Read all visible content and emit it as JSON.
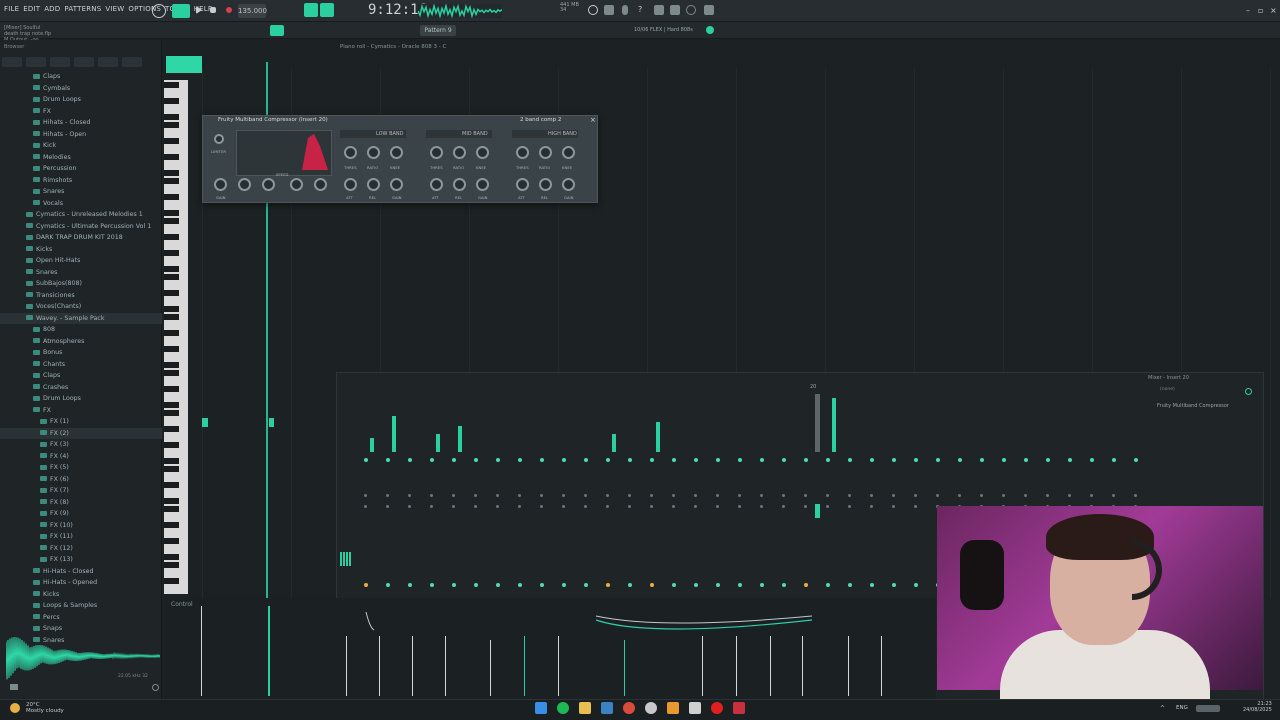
{
  "menu": [
    "FILE",
    "EDIT",
    "ADD",
    "PATTERNS",
    "VIEW",
    "OPTIONS",
    "TOOLS",
    "HELP"
  ],
  "hint_lines": [
    "[Mixer] Soulful",
    "death trap note.flp",
    "M Output: -oo"
  ],
  "tempo": "135.000",
  "time": "9:12:16",
  "pattern": "Pattern 9",
  "song_info": "10/06  FLEX | Hard 808s",
  "browser_title": "Browser",
  "pianoroll_title": "Piano roll - Cymatics - Oracle 808 3 - C",
  "tree": [
    {
      "label": "Claps",
      "indent": 1
    },
    {
      "label": "Cymbals",
      "indent": 1
    },
    {
      "label": "Drum Loops",
      "indent": 1
    },
    {
      "label": "FX",
      "indent": 1
    },
    {
      "label": "Hihats - Closed",
      "indent": 1
    },
    {
      "label": "Hihats - Open",
      "indent": 1
    },
    {
      "label": "Kick",
      "indent": 1
    },
    {
      "label": "Melodies",
      "indent": 1
    },
    {
      "label": "Percussion",
      "indent": 1
    },
    {
      "label": "Rimshots",
      "indent": 1
    },
    {
      "label": "Snares",
      "indent": 1
    },
    {
      "label": "Vocals",
      "indent": 1
    },
    {
      "label": "Cymatics - Unreleased Melodies 1",
      "indent": 0
    },
    {
      "label": "Cymatics - Ultimate Percussion Vol 1",
      "indent": 0
    },
    {
      "label": "DARK TRAP DRUM KIT 2018",
      "indent": 0
    },
    {
      "label": "Kicks",
      "indent": 0
    },
    {
      "label": "Open Hit-Hats",
      "indent": 0
    },
    {
      "label": "Snares",
      "indent": 0
    },
    {
      "label": "SubBajos(808)",
      "indent": 0
    },
    {
      "label": "Transiciones",
      "indent": 0
    },
    {
      "label": "Voces(Chants)",
      "indent": 0
    },
    {
      "label": "Wavey. - Sample Pack",
      "indent": 0,
      "selected": true
    },
    {
      "label": "808",
      "indent": 1
    },
    {
      "label": "Atmospheres",
      "indent": 1
    },
    {
      "label": "Bonus",
      "indent": 1
    },
    {
      "label": "Chants",
      "indent": 1
    },
    {
      "label": "Claps",
      "indent": 1
    },
    {
      "label": "Crashes",
      "indent": 1
    },
    {
      "label": "Drum Loops",
      "indent": 1
    },
    {
      "label": "FX",
      "indent": 1
    },
    {
      "label": "FX (1)",
      "indent": 2
    },
    {
      "label": "FX (2)",
      "indent": 2,
      "selected": true
    },
    {
      "label": "FX (3)",
      "indent": 2
    },
    {
      "label": "FX (4)",
      "indent": 2
    },
    {
      "label": "FX (5)",
      "indent": 2
    },
    {
      "label": "FX (6)",
      "indent": 2
    },
    {
      "label": "FX (7)",
      "indent": 2
    },
    {
      "label": "FX (8)",
      "indent": 2
    },
    {
      "label": "FX (9)",
      "indent": 2
    },
    {
      "label": "FX (10)",
      "indent": 2
    },
    {
      "label": "FX (11)",
      "indent": 2
    },
    {
      "label": "FX (12)",
      "indent": 2
    },
    {
      "label": "FX (13)",
      "indent": 2
    },
    {
      "label": "Hi-Hats - Closed",
      "indent": 1
    },
    {
      "label": "Hi-Hats - Opened",
      "indent": 1
    },
    {
      "label": "Kicks",
      "indent": 1
    },
    {
      "label": "Loops & Samples",
      "indent": 1
    },
    {
      "label": "Percs",
      "indent": 1
    },
    {
      "label": "Snaps",
      "indent": 1
    },
    {
      "label": "Snares",
      "indent": 1
    }
  ],
  "wave_label": "22.05 kHz  32",
  "plugin": {
    "title": "Fruity Multiband Compressor (Insert 20)",
    "preset": "2 band comp 2",
    "bands": [
      "LOW BAND",
      "MID BAND",
      "HIGH BAND"
    ],
    "knob_labels": [
      "THRES",
      "RATIO",
      "KNEE"
    ],
    "knob_labels2": [
      "ATT",
      "REL",
      "GAIN"
    ],
    "limiter": "LIMITER",
    "speed": "SPEED",
    "gain": "GAIN"
  },
  "mixer": {
    "title": "Mixer - Insert 20",
    "insert": "(none)",
    "slot": "Fruity Multiband Compressor",
    "track_marker": "20"
  },
  "control_label": "Control",
  "weather": {
    "temp": "20°C",
    "desc": "Mostly cloudy"
  },
  "tray": "ENG",
  "clock": {
    "time": "21:23",
    "date": "24/08/2025"
  },
  "colors": {
    "accent": "#2ad0a0",
    "plugin_curve": "#e0204a"
  }
}
